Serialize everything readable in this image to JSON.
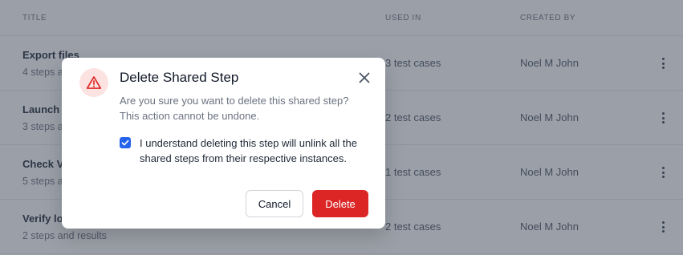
{
  "table": {
    "headers": {
      "title": "TITLE",
      "used_in": "USED IN",
      "created_by": "CREATED BY"
    },
    "rows": [
      {
        "title": "Export files",
        "subtitle": "4 steps and results",
        "used_in": "3 test cases",
        "created_by": "Noel M John"
      },
      {
        "title": "Launch the app",
        "subtitle": "3 steps and results",
        "used_in": "2 test cases",
        "created_by": "Noel M John"
      },
      {
        "title": "Check Version",
        "subtitle": "5 steps and results",
        "used_in": "1 test cases",
        "created_by": "Noel M John"
      },
      {
        "title": "Verify login",
        "subtitle": "2 steps and results",
        "used_in": "2 test cases",
        "created_by": "Noel M John"
      }
    ],
    "row_menu_icon": "more-vertical-icon"
  },
  "modal": {
    "icon": "warning-triangle-icon",
    "title": "Delete Shared Step",
    "description_line1": "Are you sure you want to delete this shared step?",
    "description_line2": "This action cannot be undone.",
    "checkbox_checked": true,
    "checkbox_label": "I understand deleting this step will unlink all the shared steps from their respective instances.",
    "cancel_label": "Cancel",
    "delete_label": "Delete",
    "close_icon": "close-icon"
  },
  "colors": {
    "accent": "#2563eb",
    "danger": "#dc2626",
    "danger_soft": "#fde2e2",
    "overlay": "rgba(55,65,81,0.5)"
  }
}
